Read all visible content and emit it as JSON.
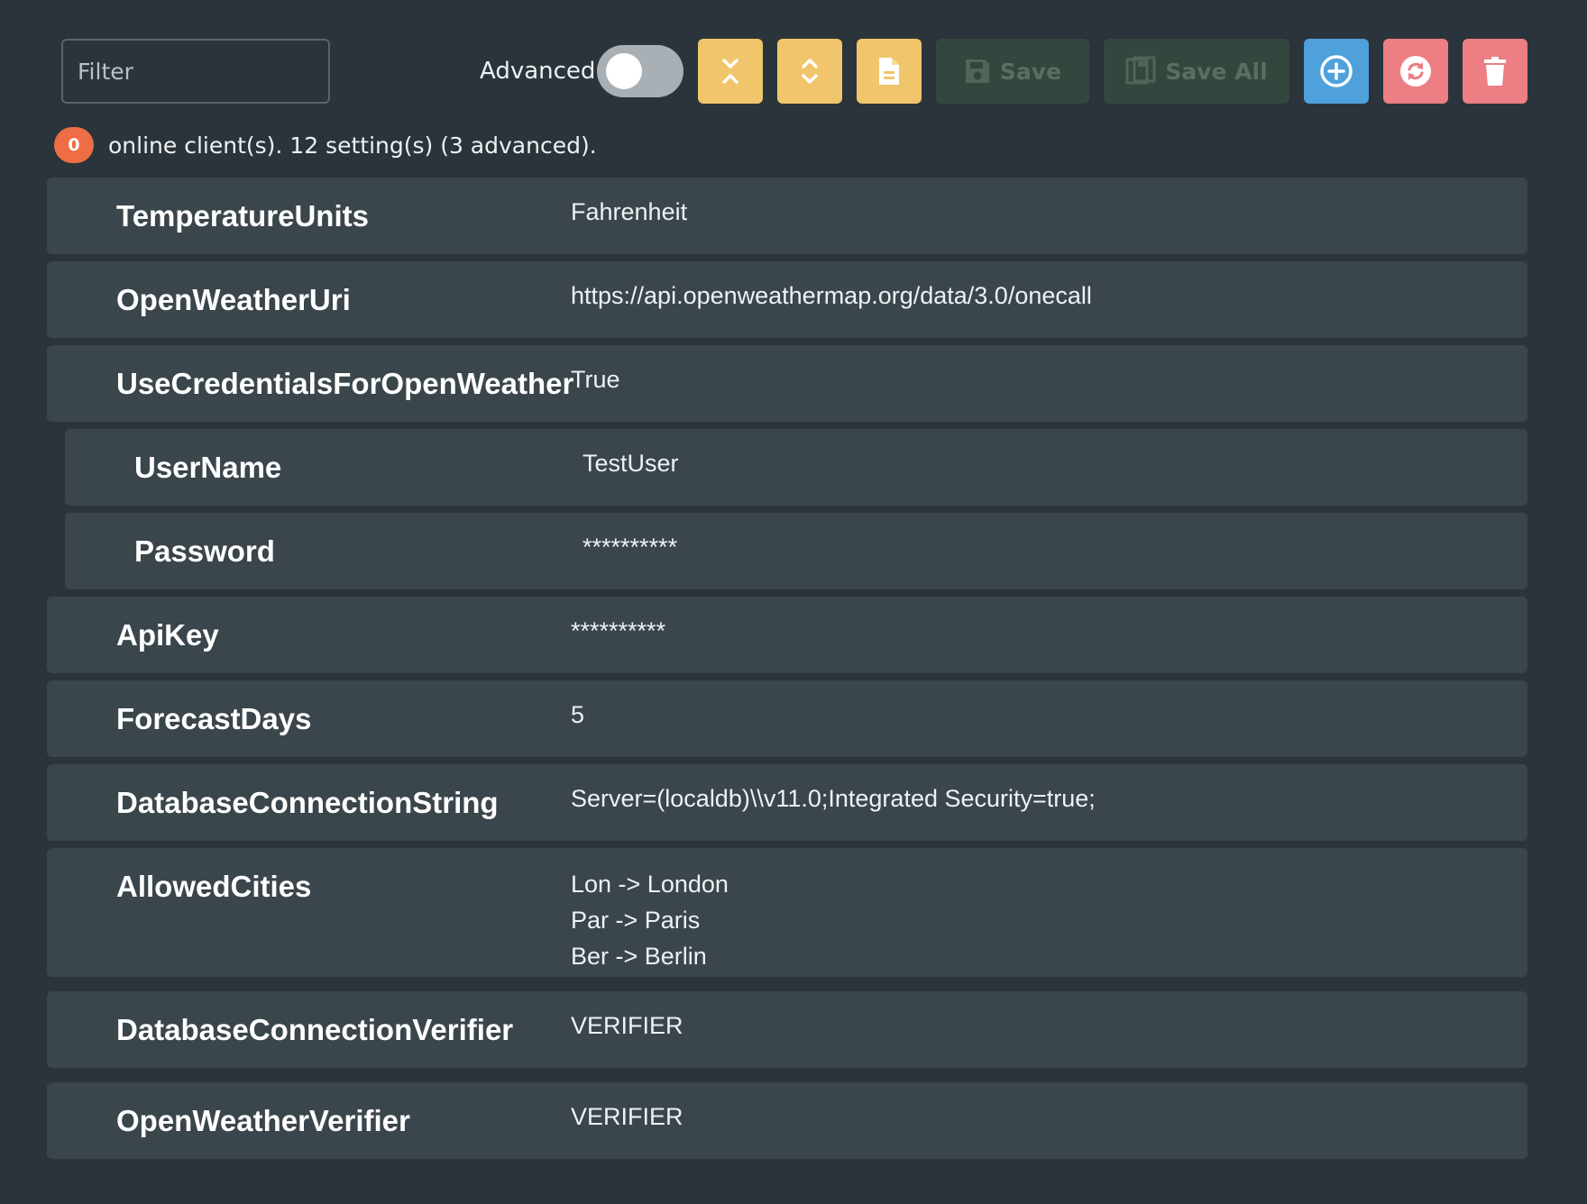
{
  "toolbar": {
    "filter_placeholder": "Filter",
    "advanced_label": "Advanced",
    "advanced_enabled": false,
    "save_label": "Save",
    "save_all_label": "Save All"
  },
  "status": {
    "online_count": "0",
    "text": "online client(s). 12 setting(s) (3 advanced)."
  },
  "settings": [
    {
      "name": "TemperatureUnits",
      "value": "Fahrenheit"
    },
    {
      "name": "OpenWeatherUri",
      "value": "https://api.openweathermap.org/data/3.0/onecall"
    },
    {
      "name": "UseCredentialsForOpenWeather",
      "value": "True"
    },
    {
      "name": "UserName",
      "value": "TestUser"
    },
    {
      "name": "Password",
      "value": "**********"
    },
    {
      "name": "ApiKey",
      "value": "**********"
    },
    {
      "name": "ForecastDays",
      "value": "5"
    },
    {
      "name": "DatabaseConnectionString",
      "value": "Server=(localdb)\\\\v11.0;Integrated Security=true;"
    },
    {
      "name": "AllowedCities",
      "values": [
        "Lon -> London",
        "Par -> Paris",
        "Ber -> Berlin"
      ]
    },
    {
      "name": "DatabaseConnectionVerifier",
      "value": "VERIFIER"
    },
    {
      "name": "OpenWeatherVerifier",
      "value": "VERIFIER"
    }
  ],
  "colors": {
    "background": "#2b343a",
    "row": "#3a454c",
    "accent_yellow": "#f1c56b",
    "accent_blue": "#4ea1db",
    "accent_red": "#ec7e84",
    "badge": "#ee6d44"
  }
}
